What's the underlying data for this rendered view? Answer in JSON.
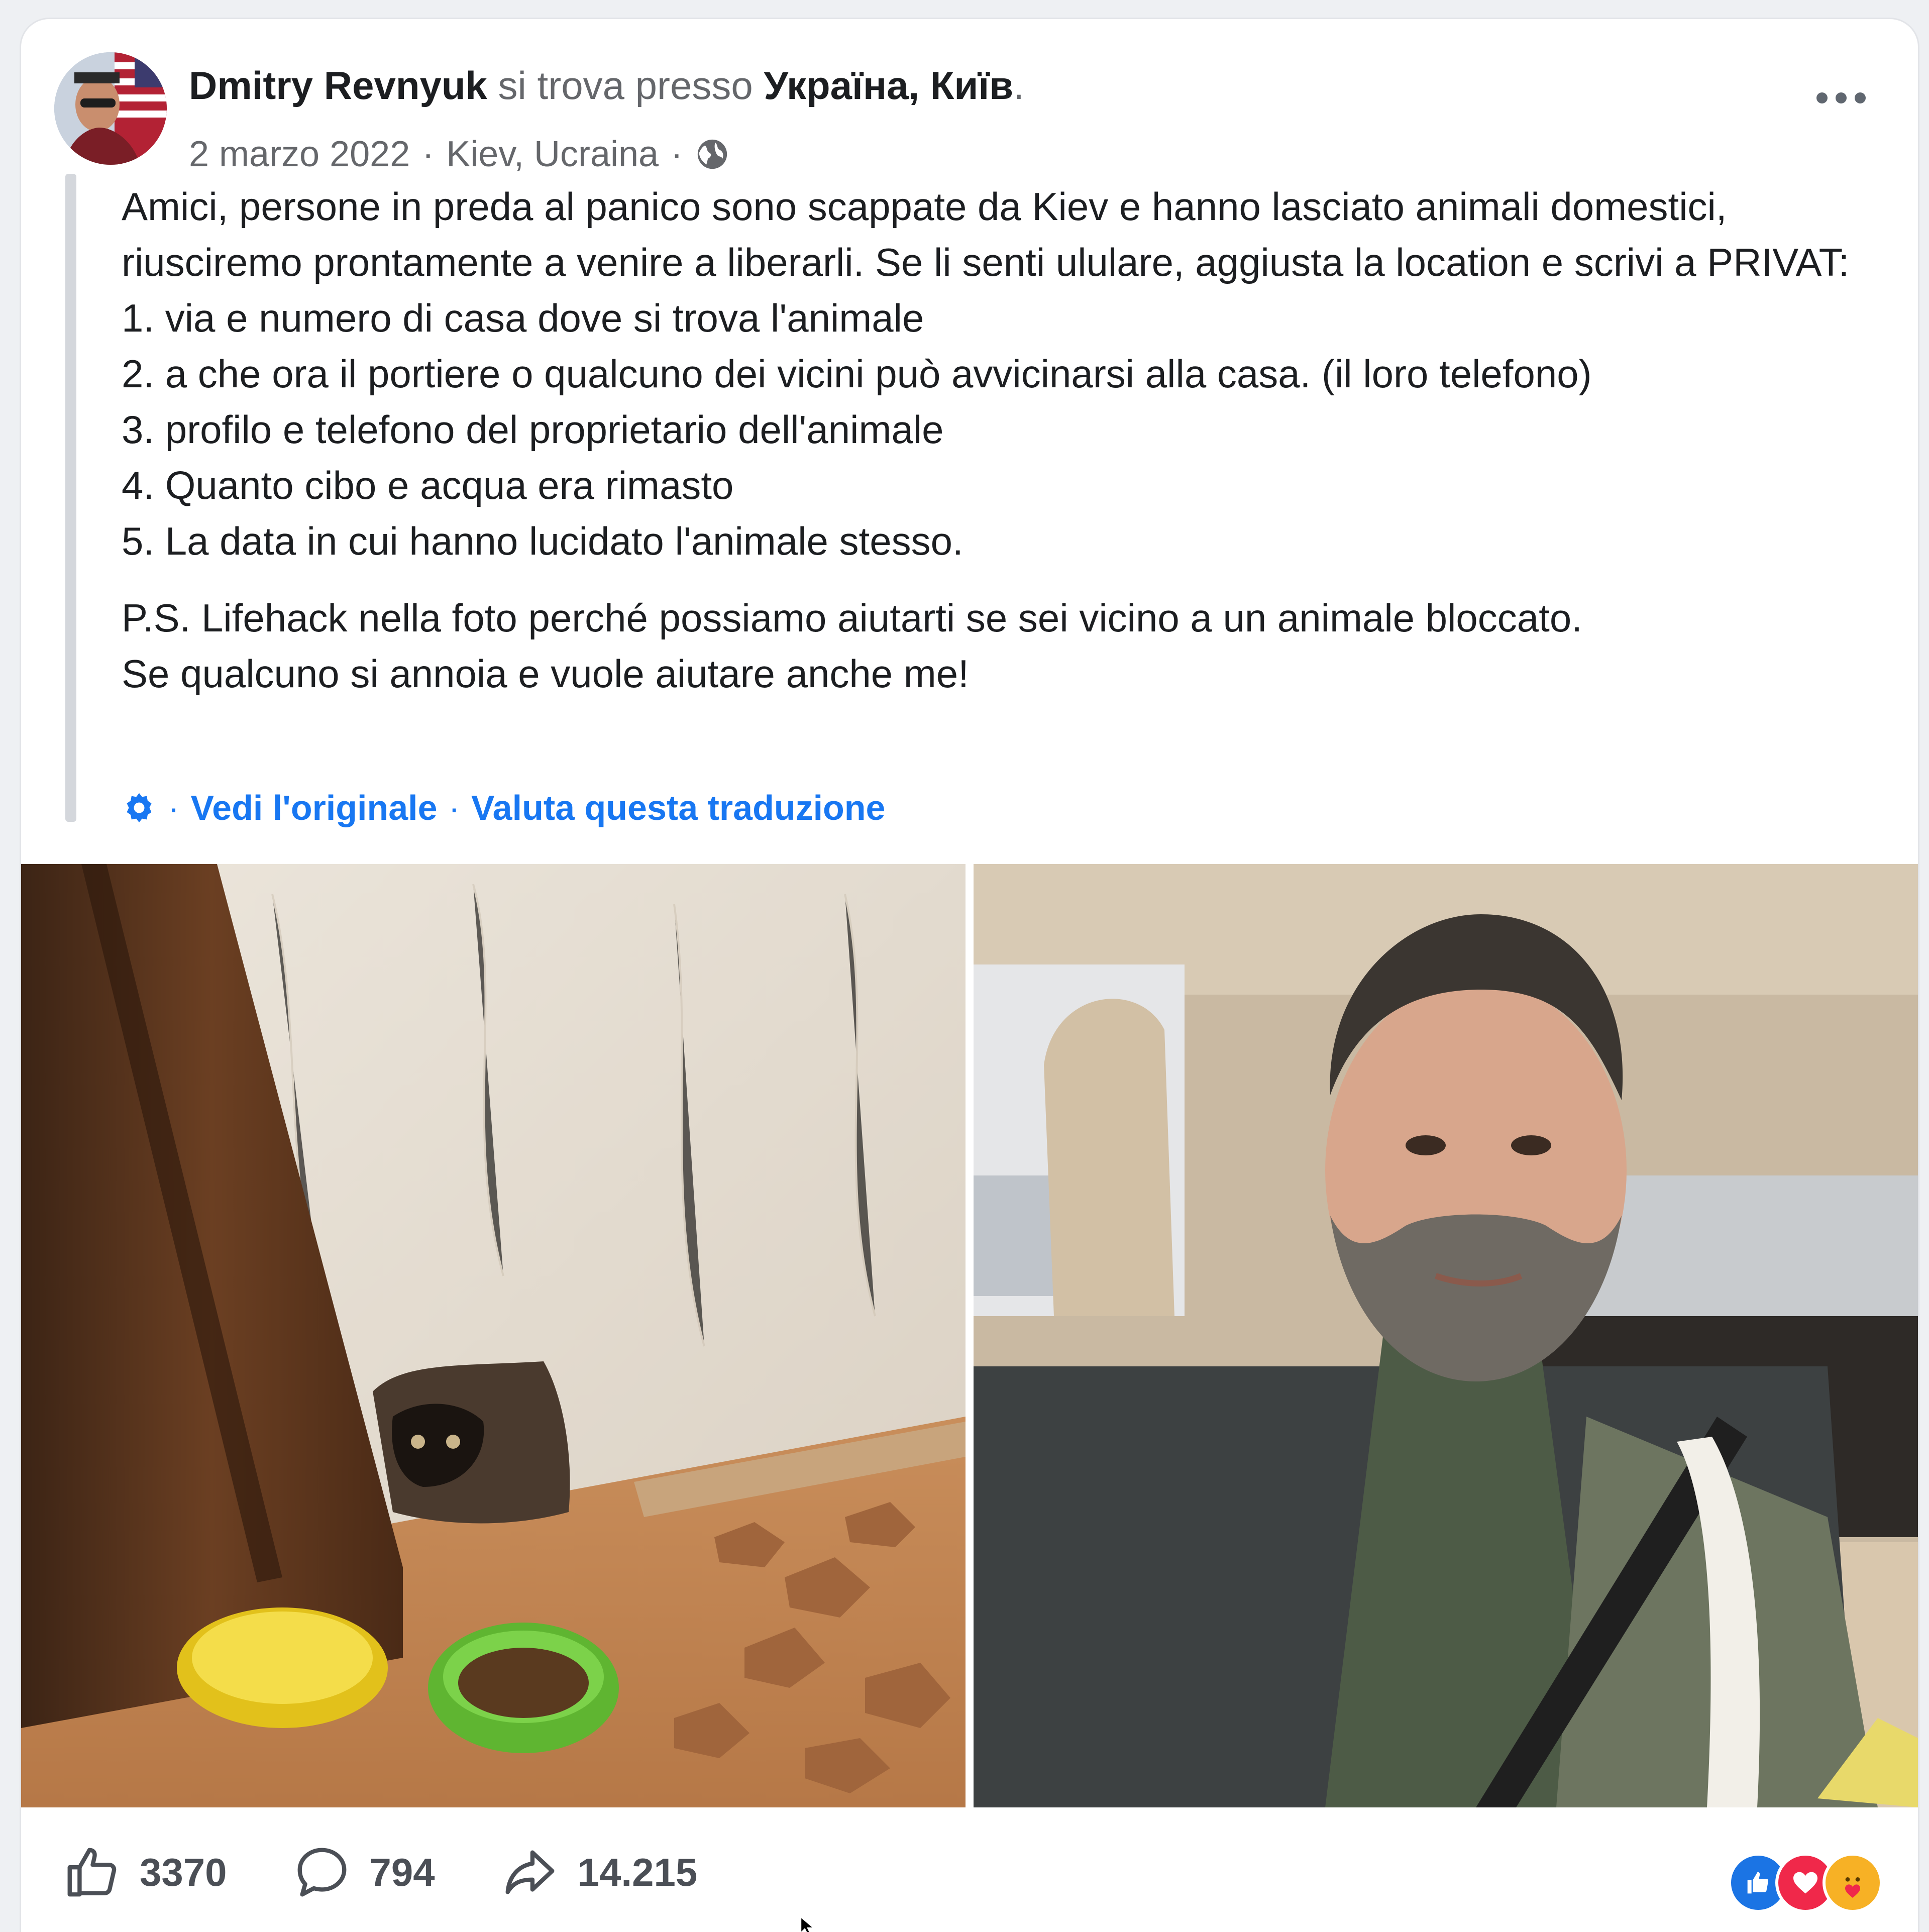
{
  "post": {
    "author": "Dmitry Revnyuk",
    "location_prefix": "si trova presso",
    "location": "Україна, Київ",
    "location_suffix": ".",
    "date": "2 marzo 2022",
    "dot": "·",
    "city": "Kiev, Ucraina",
    "privacy_icon": "globe-icon",
    "lines": [
      "Amici, persone in preda al panico sono scappate da Kiev e hanno lasciato animali domestici, riusciremo prontamente a venire a liberarli. Se li senti ululare, aggiusta la location e scrivi a PRIVAT:",
      "1. via e numero di casa dove si trova l'animale",
      "2. a che ora il portiere o qualcuno dei vicini può avvicinarsi alla casa. (il loro telefono)",
      "3. profilo e telefono del proprietario dell'animale",
      "4. Quanto cibo e acqua era rimasto",
      "5. La data in cui hanno lucidato l'animale stesso."
    ],
    "ps_lines": [
      "P.S. Lifehack nella foto perché possiamo aiutarti se sei vicino a un animale bloccato.",
      "Se qualcuno si annoia e vuole aiutare anche me!"
    ],
    "translation": {
      "see_original": "Vedi l'originale",
      "rate_translation": "Valuta questa traduzione",
      "separator": "·"
    }
  },
  "stats": {
    "likes": "3370",
    "comments": "794",
    "shares": "14.215"
  },
  "reactions": [
    "like-reaction-icon",
    "love-reaction-icon",
    "care-reaction-icon"
  ],
  "colors": {
    "link": "#1877f2",
    "muted": "#65676b",
    "like_blue": "#1b74e4",
    "love_red": "#f0284a",
    "care_yellow": "#f7b125"
  }
}
